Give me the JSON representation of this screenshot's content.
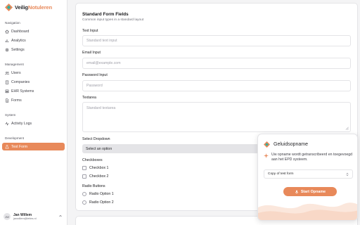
{
  "brand": {
    "name_part1": "Veilig",
    "name_part2": "Notuleren"
  },
  "sidebar": {
    "sections": [
      {
        "title": "Navigation",
        "items": [
          {
            "label": "Dashboard",
            "icon": "home-icon"
          },
          {
            "label": "Analytics",
            "icon": "chart-icon"
          },
          {
            "label": "Settings",
            "icon": "gear-icon"
          }
        ]
      },
      {
        "title": "Management",
        "items": [
          {
            "label": "Users",
            "icon": "users-icon"
          },
          {
            "label": "Companies",
            "icon": "building-icon"
          },
          {
            "label": "EHR Systems",
            "icon": "database-icon"
          },
          {
            "label": "Forms",
            "icon": "document-icon"
          }
        ]
      },
      {
        "title": "System",
        "items": [
          {
            "label": "Activity Logs",
            "icon": "activity-icon"
          }
        ]
      },
      {
        "title": "Development",
        "items": [
          {
            "label": "Test Form",
            "icon": "test-icon",
            "active": true
          }
        ]
      }
    ],
    "user": {
      "initials": "JW",
      "name": "Jan Willem",
      "email": "janwillem@lettes.nl"
    }
  },
  "form": {
    "title": "Standard Form Fields",
    "subtitle": "Common input types in a standard layout",
    "text_input": {
      "label": "Text Input",
      "placeholder": "Standard text input"
    },
    "email_input": {
      "label": "Email Input",
      "placeholder": "email@example.com"
    },
    "password_input": {
      "label": "Password Input",
      "placeholder": "Password"
    },
    "textarea": {
      "label": "Textarea",
      "placeholder": "Standard textarea"
    },
    "select": {
      "label": "Select Dropdown",
      "value": "Select an option"
    },
    "checkboxes": {
      "label": "Checkboxes",
      "options": [
        "Checkbox 1",
        "Checkbox 2"
      ]
    },
    "radios": {
      "label": "Radio Buttons",
      "options": [
        "Radio Option 1",
        "Radio Option 2"
      ]
    }
  },
  "recorder": {
    "title": "Geluidsopname",
    "description": "Uw opname wordt getranscribeerd en toegevoegd aan het EPD systeem.",
    "select_value": "Copy of test form",
    "button_label": "Start Opname"
  },
  "colors": {
    "accent": "#e8895a",
    "brand_teal": "#2bb3a3"
  }
}
